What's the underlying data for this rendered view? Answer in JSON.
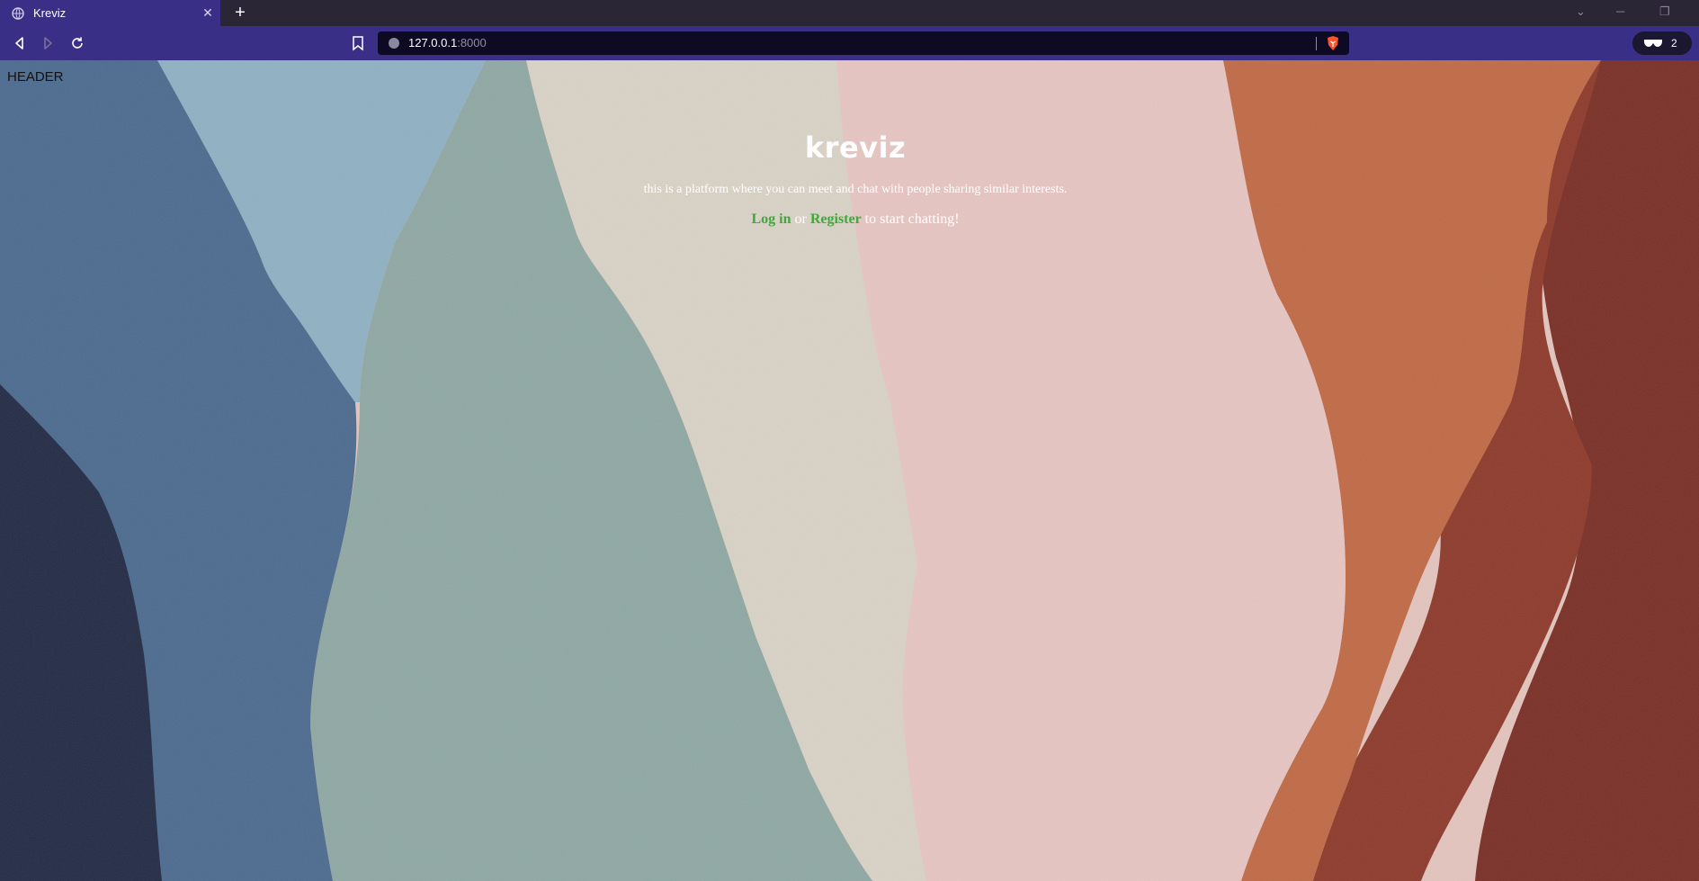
{
  "browser": {
    "tab": {
      "title": "Kreviz"
    },
    "address": {
      "host": "127.0.0.1",
      "port": ":8000"
    },
    "private_windows": "2"
  },
  "page": {
    "header_label": "HEADER",
    "title": "kreviz",
    "tagline": "this is a platform where you can meet and chat with people sharing similar interests.",
    "cta": {
      "login_label": "Log in",
      "or_text": "or",
      "register_label": "Register",
      "suffix": "to start chatting!"
    }
  },
  "colors": {
    "browser_accent": "#3a2f86",
    "link": "#3fa83a"
  }
}
